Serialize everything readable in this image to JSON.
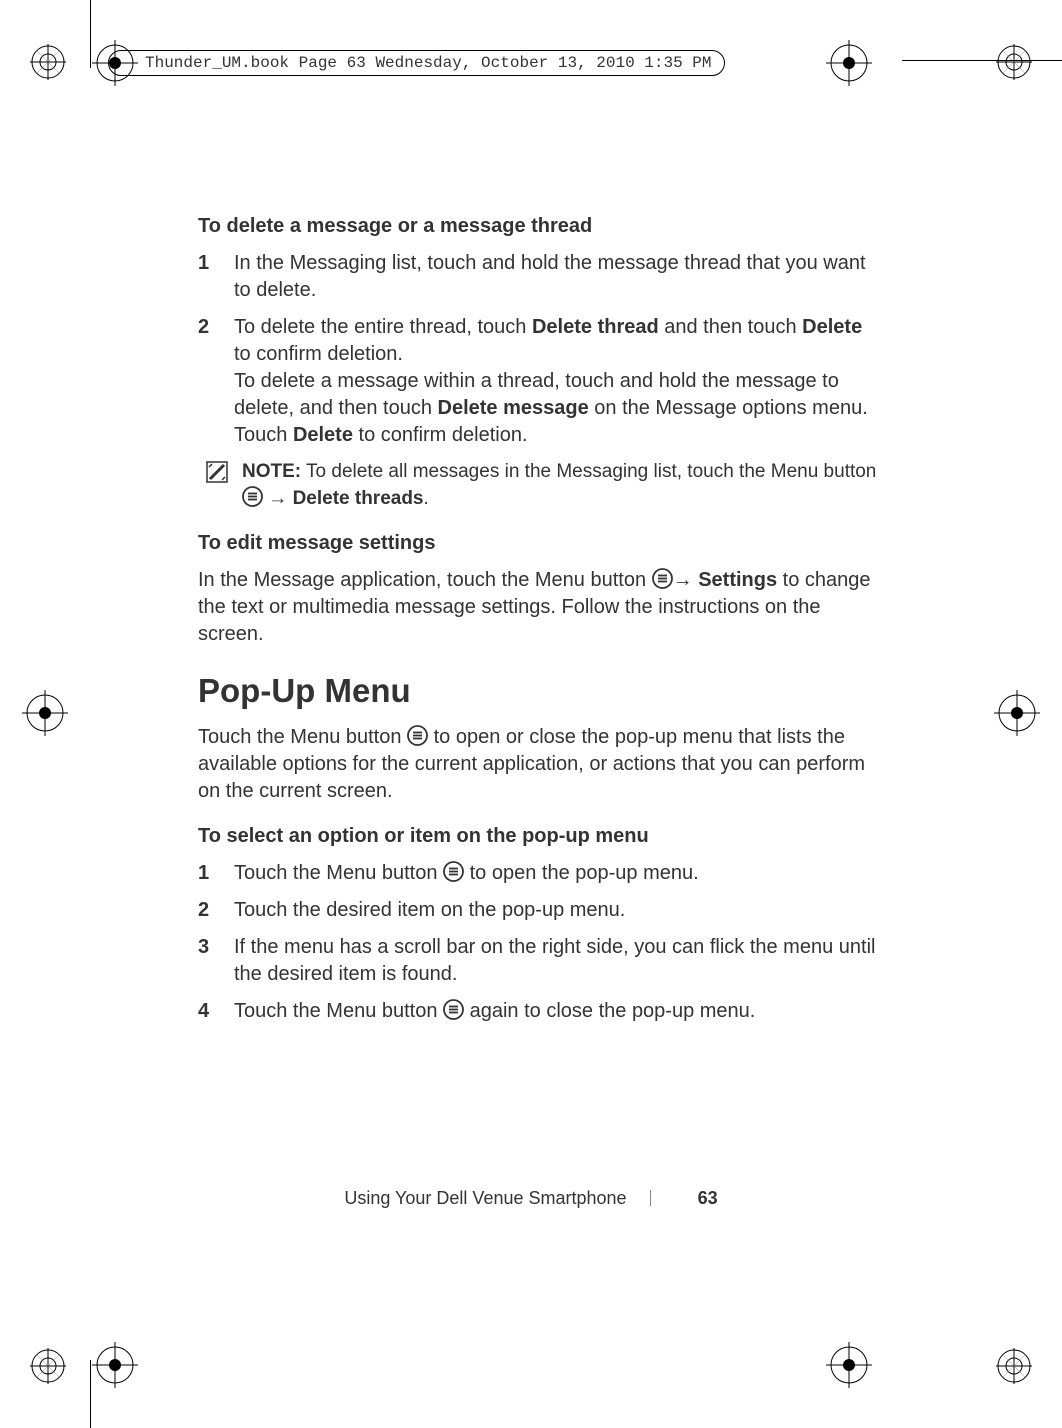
{
  "print_header": "Thunder_UM.book  Page 63  Wednesday, October 13, 2010  1:35 PM",
  "sec1": {
    "title": "To delete a message or a message thread",
    "steps": [
      {
        "num": "1",
        "text_a": "In the Messaging list, touch and hold the message thread that you want to delete."
      },
      {
        "num": "2",
        "text_a": "To delete the entire thread, touch ",
        "b1": "Delete thread",
        "text_b": " and then touch ",
        "b2": "Delete",
        "text_c": " to confirm deletion.",
        "text_d": "To delete a message within a thread, touch and hold the message to delete, and then touch ",
        "b3": "Delete message",
        "text_e": " on the Message options menu. Touch ",
        "b4": "Delete",
        "text_f": " to confirm deletion."
      }
    ],
    "note_label": "NOTE:",
    "note_a": " To delete all messages in the Messaging list, touch the Menu button ",
    "note_arrow": " → ",
    "note_b": "Delete threads",
    "note_c": "."
  },
  "sec2": {
    "title": "To edit message settings",
    "para_a": "In the Message application, touch the Menu button ",
    "para_arrow": "→ ",
    "para_b": "Settings",
    "para_c": " to change the text or multimedia message settings. Follow the instructions on the screen."
  },
  "sec3": {
    "title": "Pop-Up Menu",
    "para_a": "Touch the Menu button ",
    "para_b": " to open or close the pop-up menu that lists the available options for the current application, or actions that you can perform on the current screen."
  },
  "sec4": {
    "title": "To select an option or item on the pop-up menu",
    "steps": [
      {
        "num": "1",
        "text_a": "Touch the Menu button ",
        "text_b": " to open the pop-up menu."
      },
      {
        "num": "2",
        "text_a": "Touch the desired item on the pop-up menu."
      },
      {
        "num": "3",
        "text_a": "If the menu has a scroll bar on the right side, you can flick the menu until the desired item is found."
      },
      {
        "num": "4",
        "text_a": "Touch the Menu button ",
        "text_b": " again to close the pop-up menu."
      }
    ]
  },
  "footer": {
    "text": "Using Your Dell Venue Smartphone",
    "page": "63"
  }
}
